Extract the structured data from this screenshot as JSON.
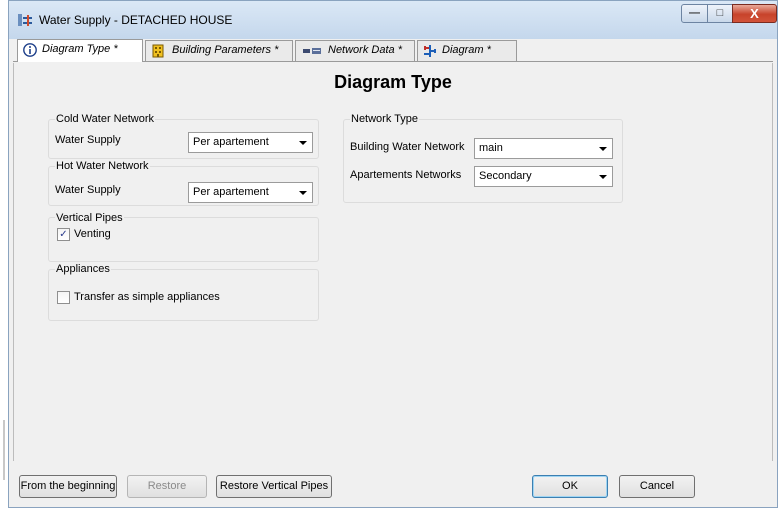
{
  "window": {
    "title": "Water Supply - DETACHED HOUSE",
    "minimize_glyph": "—",
    "maximize_glyph": "□",
    "close_glyph": "X"
  },
  "tabs": [
    {
      "label": "Diagram Type *",
      "icon": "info-icon"
    },
    {
      "label": "Building Parameters *",
      "icon": "building-icon"
    },
    {
      "label": "Network Data *",
      "icon": "network-icon"
    },
    {
      "label": "Diagram *",
      "icon": "diagram-icon"
    }
  ],
  "page_title": "Diagram Type",
  "cold_water": {
    "legend": "Cold Water Network",
    "field_label": "Water Supply",
    "value": "Per apartement"
  },
  "hot_water": {
    "legend": "Hot Water Network",
    "field_label": "Water Supply",
    "value": "Per apartement"
  },
  "vertical_pipes": {
    "legend": "Vertical Pipes",
    "venting_label": "Venting",
    "venting_checked": true
  },
  "appliances": {
    "legend": "Appliances",
    "transfer_label": "Transfer as simple appliances",
    "transfer_checked": false
  },
  "network_type": {
    "legend": "Network Type",
    "building_label": "Building Water Network",
    "building_value": "main",
    "apartments_label": "Apartements Networks",
    "apartments_value": "Secondary"
  },
  "buttons": {
    "from_beginning": "From the beginning",
    "restore": "Restore",
    "restore_vertical": "Restore Vertical Pipes",
    "ok": "OK",
    "cancel": "Cancel"
  },
  "colors": {
    "accent": "#3c7fb1",
    "close_red": "#c7432b"
  }
}
